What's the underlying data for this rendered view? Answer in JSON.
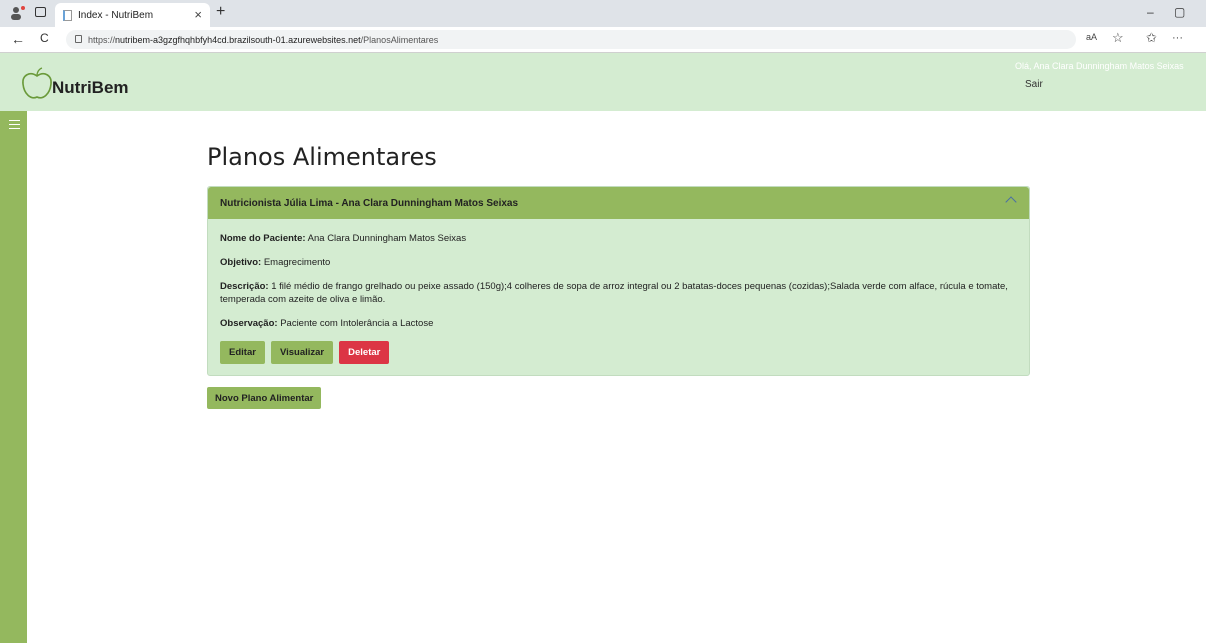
{
  "browser": {
    "tab_title": "Index - NutriBem",
    "tab_close": "×",
    "new_tab": "+",
    "url_prefix": "https://",
    "url_host": "nutribem-a3gzgfhqhbfyh4cd.brazilsouth-01.azurewebsites.net",
    "url_path": "/PlanosAlimentares",
    "reader_icon": "aA",
    "favorite_icon": "☆",
    "favorites_icon": "✩",
    "more_icon": "···",
    "minimize": "–",
    "restore": "▢",
    "back_icon": "←",
    "refresh_icon": "C"
  },
  "header": {
    "brand": "NutriBem",
    "greeting": "Olá, Ana Clara Dunningham Matos Seixas",
    "logout": "Sair"
  },
  "main": {
    "title": "Planos Alimentares",
    "card": {
      "header": "Nutricionista Júlia Lima - Ana Clara Dunningham Matos Seixas",
      "patient_label": "Nome do Paciente:",
      "patient_value": "Ana Clara Dunningham Matos Seixas",
      "goal_label": "Objetivo:",
      "goal_value": "Emagrecimento",
      "description_label": "Descrição:",
      "description_value": "1 filé médio de frango grelhado ou peixe assado (150g);4 colheres de sopa de arroz integral ou 2 batatas-doces pequenas (cozidas);Salada verde com alface, rúcula e tomate, temperada com azeite de oliva e limão.",
      "note_label": "Observação:",
      "note_value": "Paciente com Intolerância a Lactose",
      "edit": "Editar",
      "view": "Visualizar",
      "delete": "Deletar"
    },
    "new_plan": "Novo Plano Alimentar"
  },
  "colors": {
    "header_bg": "#d4ecd1",
    "accent": "#94b85e",
    "danger": "#dc3545"
  }
}
